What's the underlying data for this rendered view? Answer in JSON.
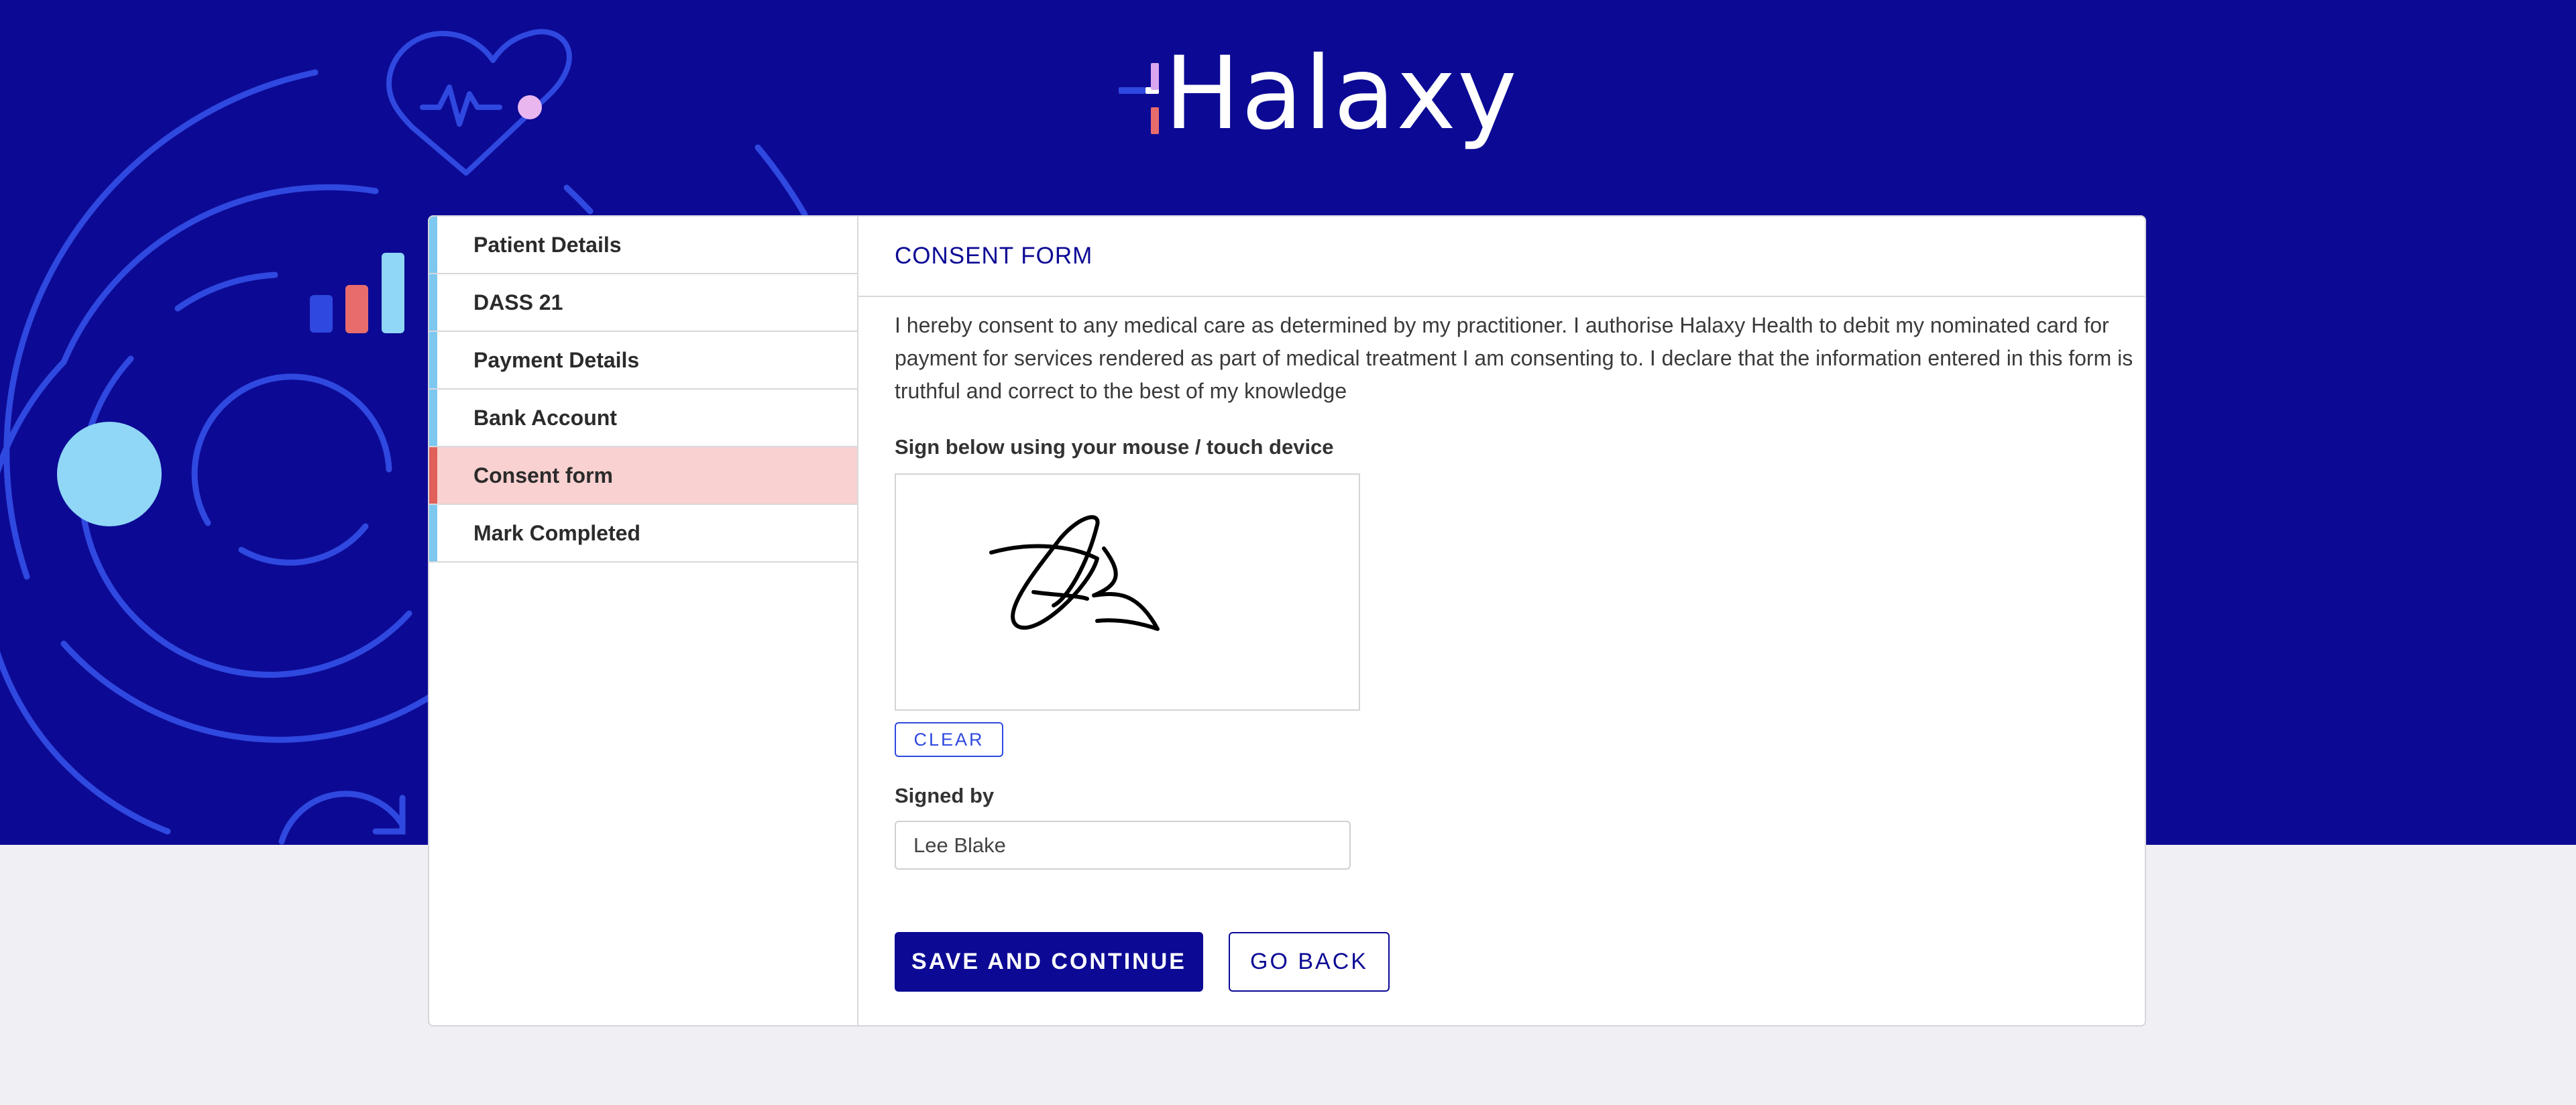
{
  "brand": {
    "logo_text": "Halaxy",
    "colors": {
      "primary": "#0c0a94",
      "accent": "#2f48e0",
      "active_nav": "#f8d1d0",
      "active_marker": "#e2605a",
      "nav_marker": "#7cc8f0"
    }
  },
  "sidebar": {
    "items": [
      {
        "label": "Patient Details",
        "active": false
      },
      {
        "label": "DASS 21",
        "active": false
      },
      {
        "label": "Payment Details",
        "active": false
      },
      {
        "label": "Bank Account",
        "active": false
      },
      {
        "label": "Consent form",
        "active": true
      },
      {
        "label": "Mark Completed",
        "active": false
      }
    ]
  },
  "form": {
    "title": "CONSENT FORM",
    "consent_text": "I hereby consent to any medical care as determined by my practitioner. I authorise Halaxy Health to debit my nominated card for payment for services rendered as part of medical treatment I am consenting to. I declare that the information entered in this form is truthful and correct to the best of my knowledge",
    "sign_label": "Sign below using your mouse / touch device",
    "clear_label": "CLEAR",
    "signed_by_label": "Signed by",
    "signed_by_value": "Lee Blake",
    "save_label": "SAVE AND CONTINUE",
    "back_label": "GO BACK"
  },
  "icons": [
    "heart-pulse-icon",
    "bar-chart-icon",
    "refresh-arrow-icon",
    "logo-plus-mark"
  ]
}
